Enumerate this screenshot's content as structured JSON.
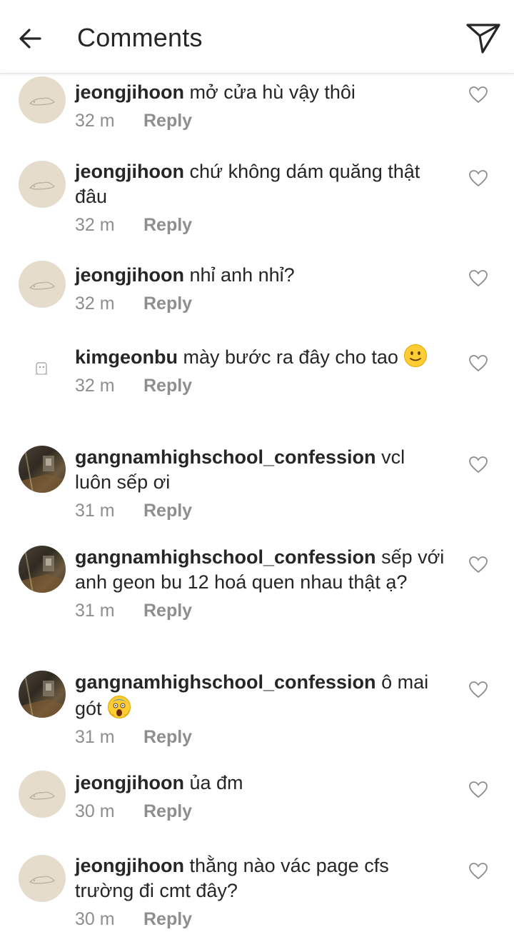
{
  "header": {
    "title": "Comments",
    "back_icon": "arrow-left-icon",
    "share_icon": "paper-plane-icon"
  },
  "colors": {
    "text": "#262626",
    "meta": "#8e8e8e",
    "avatar_beige": "#e5dccb",
    "divider": "#e3e3e3"
  },
  "comments": [
    {
      "username": "jeongjihoon",
      "text": "mở cửa hù vậy thôi",
      "time": "32 m",
      "reply": "Reply",
      "avatar": "beige"
    },
    {
      "username": "jeongjihoon",
      "text": "chứ không dám quăng thật đâu",
      "time": "32 m",
      "reply": "Reply",
      "avatar": "beige"
    },
    {
      "username": "jeongjihoon",
      "text": "nhỉ anh nhỉ?",
      "time": "32 m",
      "reply": "Reply",
      "avatar": "beige"
    },
    {
      "username": "kimgeonbu",
      "text": "mày bước ra đây cho tao",
      "emoji": "slightly-smiling-face-emoji",
      "time": "32 m",
      "reply": "Reply",
      "avatar": "white"
    },
    {
      "username": "gangnamhighschool_confession",
      "text": "vcl luôn sếp ơi",
      "time": "31 m",
      "reply": "Reply",
      "avatar": "photo"
    },
    {
      "username": "gangnamhighschool_confession",
      "text": "sếp với anh geon bu 12 hoá quen nhau thật ạ?",
      "time": "31 m",
      "reply": "Reply",
      "avatar": "photo"
    },
    {
      "username": "gangnamhighschool_confession",
      "text": "ô mai gót",
      "emoji": "screaming-face-emoji",
      "time": "31 m",
      "reply": "Reply",
      "avatar": "photo"
    },
    {
      "username": "jeongjihoon",
      "text": "ủa đm",
      "time": "30 m",
      "reply": "Reply",
      "avatar": "beige"
    },
    {
      "username": "jeongjihoon",
      "text": "thằng nào vác page cfs trường đi cmt đây?",
      "time": "30 m",
      "reply": "Reply",
      "avatar": "beige"
    }
  ]
}
